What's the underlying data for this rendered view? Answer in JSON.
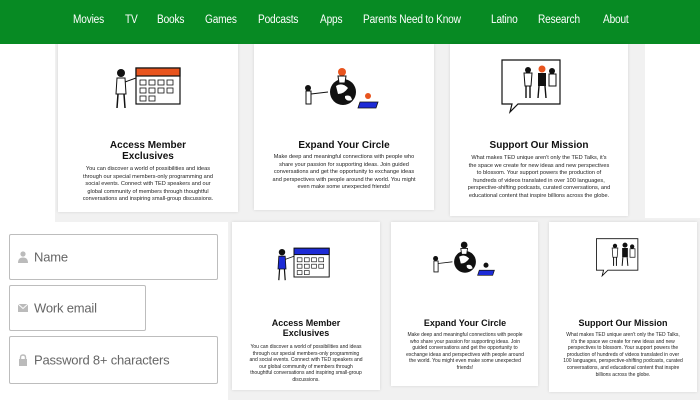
{
  "nav": {
    "items": [
      "Movies",
      "TV",
      "Books",
      "Games",
      "Podcasts",
      "Apps",
      "Parents Need to Know",
      "Latino",
      "Research",
      "About"
    ]
  },
  "cards": {
    "access_title": "Access Member Exclusives",
    "access_text": "You can discover a world of possibilities and ideas through our special members-only programming and social events. Connect with TED speakers and our global community of members through thoughtful conversations and inspiring small-group discussions.",
    "circle_title": "Expand Your Circle",
    "circle_text": "Make deep and meaningful connections with people who share your passion for supporting ideas. Join guided conversations and get the opportunity to exchange ideas and perspectives with people around the world. You might even make some unexpected friends!",
    "mission_title": "Support Our Mission",
    "mission_text": "What makes TED unique aren't only the TED Talks, it's the space we create for new ideas and new perspectives to blossom. Your support powers the production of hundreds of videos translated in over 100 languages, perspective-shifting podcasts, curated conversations, and educational content that inspire billions across the globe."
  },
  "form": {
    "name_placeholder": "Name",
    "email_placeholder": "Work email",
    "password_placeholder": "Password 8+ characters"
  },
  "colors": {
    "nav_bg": "#078a23",
    "accent_orange": "#e8541e",
    "accent_blue": "#1d2bd6"
  }
}
